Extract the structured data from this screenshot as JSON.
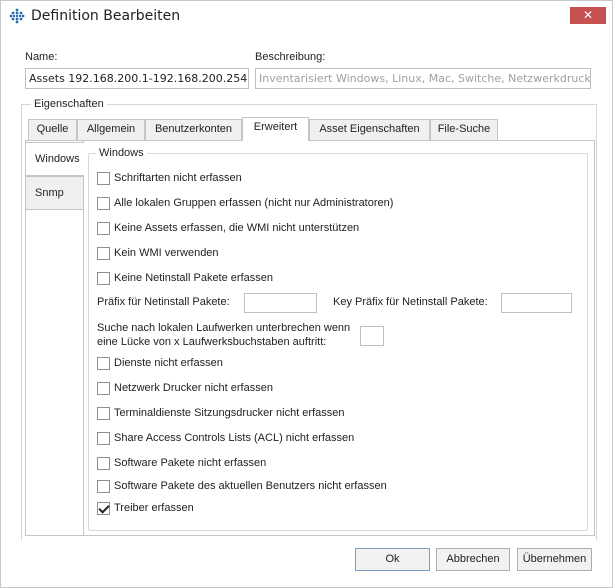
{
  "window": {
    "title": "Definition Bearbeiten",
    "close_symbol": "✕"
  },
  "form": {
    "name_label": "Name:",
    "name_value": "Assets 192.168.200.1-192.168.200.254",
    "description_label": "Beschreibung:",
    "description_placeholder": "Inventarisiert Windows, Linux, Mac, Switche, Netzwerkdrucker, Hype"
  },
  "properties_label": "Eigenschaften",
  "tabs": [
    {
      "label": "Quelle"
    },
    {
      "label": "Allgemein"
    },
    {
      "label": "Benutzerkonten"
    },
    {
      "label": "Erweitert",
      "active": true
    },
    {
      "label": "Asset Eigenschaften"
    },
    {
      "label": "File-Suche"
    }
  ],
  "side_tabs": [
    {
      "label": "Windows",
      "active": true
    },
    {
      "label": "Snmp"
    }
  ],
  "windows_group": {
    "legend": "Windows",
    "options": [
      {
        "label": "Schriftarten nicht erfassen",
        "checked": false
      },
      {
        "label": "Alle lokalen Gruppen erfassen (nicht nur Administratoren)",
        "checked": false
      },
      {
        "label": "Keine Assets erfassen, die WMI nicht unterstützen",
        "checked": false
      },
      {
        "label": "Kein WMI verwenden",
        "checked": false
      },
      {
        "label": "Keine Netinstall Pakete erfassen",
        "checked": false
      }
    ],
    "prefix_label": "Präfix für Netinstall Pakete:",
    "prefix_value": "",
    "key_prefix_label": "Key Präfix für Netinstall Pakete:",
    "key_prefix_value": "",
    "drive_gap_label_line1": "Suche nach lokalen Laufwerken unterbrechen wenn",
    "drive_gap_label_line2": "eine Lücke von x Laufwerksbuchstaben auftritt:",
    "drive_gap_value": "",
    "options2": [
      {
        "label": "Dienste nicht erfassen",
        "checked": false
      },
      {
        "label": "Netzwerk Drucker nicht erfassen",
        "checked": false
      },
      {
        "label": "Terminaldienste Sitzungsdrucker nicht erfassen",
        "checked": false
      },
      {
        "label": "Share Access Controls Lists (ACL) nicht erfassen",
        "checked": false
      },
      {
        "label": "Software Pakete nicht erfassen",
        "checked": false
      },
      {
        "label": "Software Pakete des aktuellen Benutzers nicht erfassen",
        "checked": false
      },
      {
        "label": "Treiber erfassen",
        "checked": true
      }
    ]
  },
  "buttons": {
    "ok": "Ok",
    "cancel": "Abbrechen",
    "apply": "Übernehmen"
  },
  "colors": {
    "close": "#c75050",
    "icon_blue": "#2b6cb0"
  }
}
